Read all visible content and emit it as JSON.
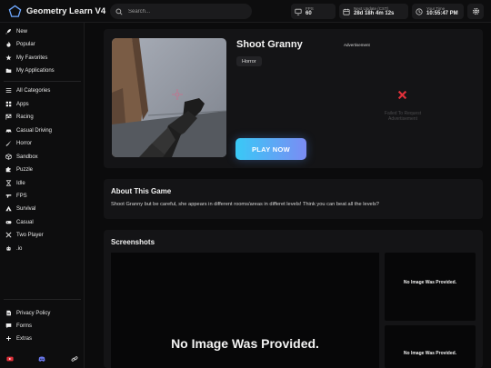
{
  "app": {
    "title": "Geometry Learn V4"
  },
  "search": {
    "placeholder": "Search..."
  },
  "stats": {
    "fps": {
      "label": "FPS",
      "value": "60"
    },
    "next_update": {
      "label": "Next Update (CST)",
      "value": "28d 18h 4m 12s"
    },
    "your_time": {
      "label": "Your Time",
      "value": "10:55:47 PM"
    }
  },
  "sidebar": {
    "top": [
      "New",
      "Popular",
      "My Favorites",
      "My Applications"
    ],
    "categories": [
      "All Categories",
      "Apps",
      "Racing",
      "Casual Driving",
      "Horror",
      "Sandbox",
      "Puzzle",
      "Idle",
      "FPS",
      "Survival",
      "Casual",
      "Two Player",
      ".io"
    ],
    "bottom": [
      "Privacy Policy",
      "Forms",
      "Extras"
    ]
  },
  "game": {
    "title": "Shoot Granny",
    "tag": "Horror",
    "play_label": "PLAY NOW",
    "ad_label": "Advertisement",
    "ad_error_line1": "Failed To Request",
    "ad_error_line2": "Advertisement"
  },
  "about": {
    "title": "About This Game",
    "text": "Shoot Granny but be careful, she appears in different rooms/areas in differet levels! Think you can beat all the levels?"
  },
  "screenshots": {
    "title": "Screenshots",
    "empty_large": "No Image Was Provided.",
    "empty_small_1": "No Image Was Provided.",
    "empty_small_2": "No Image Was Provided."
  },
  "colors": {
    "accent_start": "#39c9f6",
    "accent_end": "#7b8cf4",
    "error": "#e0303a"
  }
}
